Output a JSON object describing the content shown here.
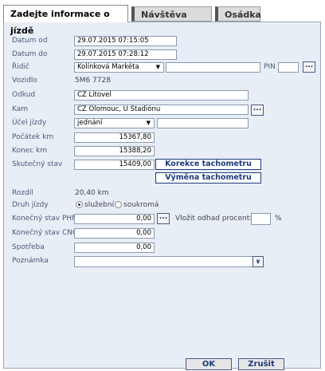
{
  "tabs": [
    {
      "label": "Zadejte informace o jízdě",
      "active": true
    },
    {
      "label": "Návštěva firmy",
      "active": false
    },
    {
      "label": "Osádka",
      "active": false
    }
  ],
  "fields": {
    "datum_od": {
      "label": "Datum od",
      "value": "29.07.2015 07:15:05"
    },
    "datum_do": {
      "label": "Datum do",
      "value": "29.07.2015 07:28:12"
    },
    "ridic": {
      "label": "Řidič",
      "selected": "Kolínková Markéta",
      "extra": "",
      "pin_label": "PIN",
      "pin": ""
    },
    "vozidlo": {
      "label": "Vozidlo",
      "value": "5M6 7728"
    },
    "odkud": {
      "label": "Odkud",
      "value": "CZ Litovel"
    },
    "kam": {
      "label": "Kam",
      "value": "CZ Olomouc, U Stadiónu"
    },
    "ucel": {
      "label": "Účel jízdy",
      "selected": "jednání",
      "extra": ""
    },
    "pocatek_km": {
      "label": "Počátek km",
      "value": "15367,80"
    },
    "konec_km": {
      "label": "Konec km",
      "value": "15388,20"
    },
    "skutecny_stav": {
      "label": "Skutečný stav",
      "value": "15409,00"
    },
    "rozdil": {
      "label": "Rozdíl",
      "value": "20,40 km"
    },
    "druh": {
      "label": "Druh jízdy",
      "options": [
        "služební",
        "soukromá"
      ],
      "selected": "služební"
    },
    "konecny_phm": {
      "label": "Konečný stav PHM",
      "value": "0,00"
    },
    "odhad": {
      "label": "Vložit odhad procent:",
      "value": "",
      "unit": "%"
    },
    "konecny_cng": {
      "label": "Konečný stav CNG",
      "value": "0,00"
    },
    "spotreba": {
      "label": "Spotřeba",
      "value": "0,00"
    },
    "poznamka": {
      "label": "Poznámka",
      "value": ""
    }
  },
  "buttons": {
    "korekce": "Korekce tachometru",
    "vymena": "Výměna tachometru",
    "dots": "...",
    "ok": "OK",
    "zrusit": "Zrušit"
  }
}
